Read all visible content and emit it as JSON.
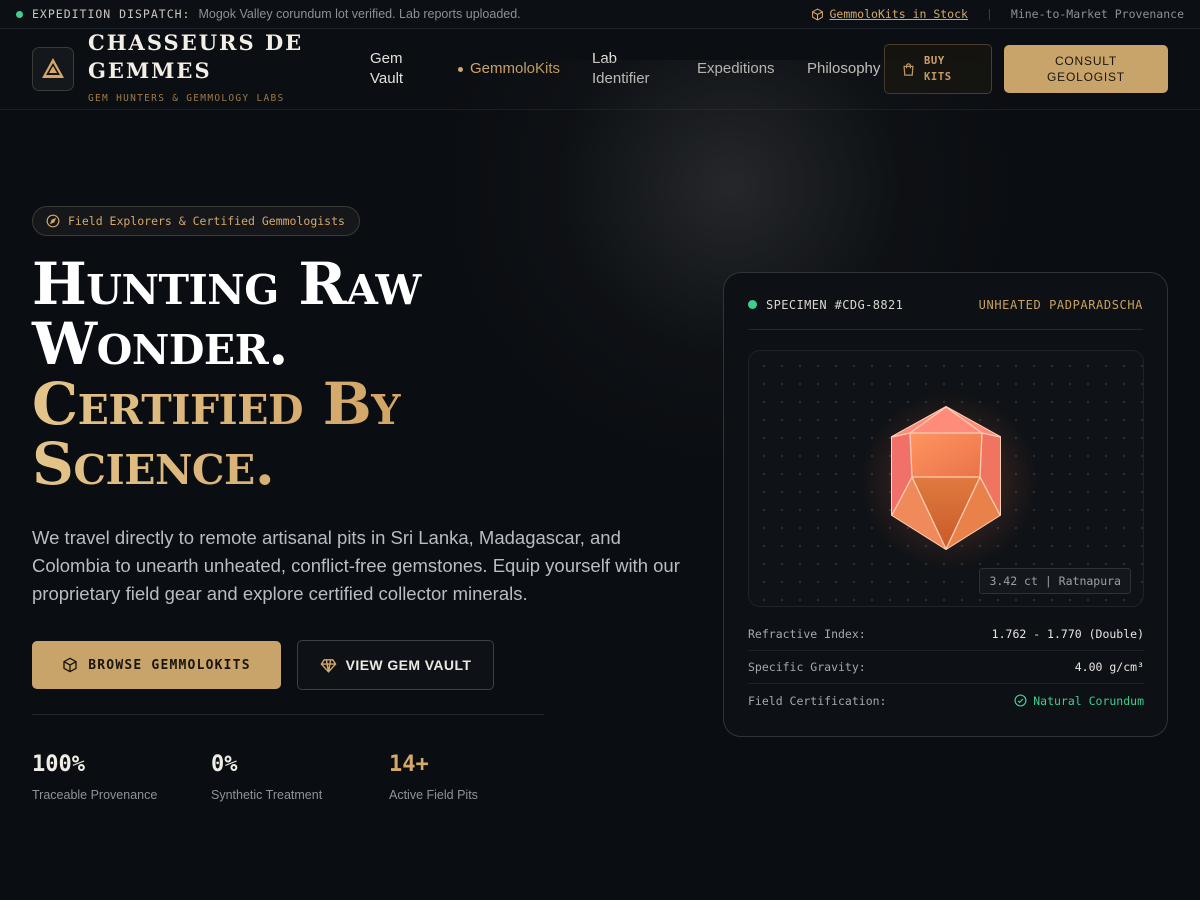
{
  "dispatch": {
    "label": "EXPEDITION DISPATCH:",
    "message": "Mogok Valley corundum lot verified. Lab reports uploaded.",
    "kits_link": "GemmoloKits in Stock",
    "separator": "|",
    "provenance": "Mine-to-Market Provenance",
    "status_color": "#3ecf8e"
  },
  "header": {
    "brand_line1": "CHASSEURS DE",
    "brand_line2": "GEMMES",
    "tagline": "GEM HUNTERS & GEMMOLOGY LABS",
    "logo_icon": "gem-triangle-icon",
    "nav": [
      {
        "line1": "Gem",
        "line2": "Vault"
      },
      {
        "label": "GemmoloKits",
        "active": true
      },
      {
        "line1": "Lab",
        "line2": "Identifier"
      },
      {
        "label": "Expeditions"
      },
      {
        "label": "Philosophy"
      }
    ],
    "buy_line1": "BUY",
    "buy_line2": "KITS",
    "consult_line1": "CONSULT",
    "consult_line2": "GEOLOGIST"
  },
  "hero": {
    "badge": "Field Explorers & Certified Gemmologists",
    "title_line1": "Hunting Raw",
    "title_line2": "Wonder.",
    "title_line3": "Certified By",
    "title_line4": "Science.",
    "lead": "We travel directly to remote artisanal pits in Sri Lanka, Madagascar, and Colombia to unearth unheated, conflict-free gemstones. Equip yourself with our proprietary field gear and explore certified collector minerals.",
    "primary_button": "BROWSE GEMMOLOKITS",
    "secondary_button": "VIEW GEM VAULT",
    "accent_color": "#c9a46a",
    "stats": [
      {
        "value": "100%",
        "label": "Traceable Provenance"
      },
      {
        "value": "0%",
        "label": "Synthetic Treatment"
      },
      {
        "value": "14+",
        "label": "Active Field Pits"
      }
    ]
  },
  "specimen": {
    "id": "SPECIMEN #CDG-8821",
    "type": "UNHEATED PADPARADSCHA",
    "carat_tag": "3.42 ct | Ratnapura",
    "properties": [
      {
        "key": "Refractive Index:",
        "value": "1.762 - 1.770 (Double)"
      },
      {
        "key": "Specific Gravity:",
        "value": "4.00 g/cm³"
      },
      {
        "key": "Field Certification:",
        "value": "Natural Corundum"
      }
    ]
  }
}
